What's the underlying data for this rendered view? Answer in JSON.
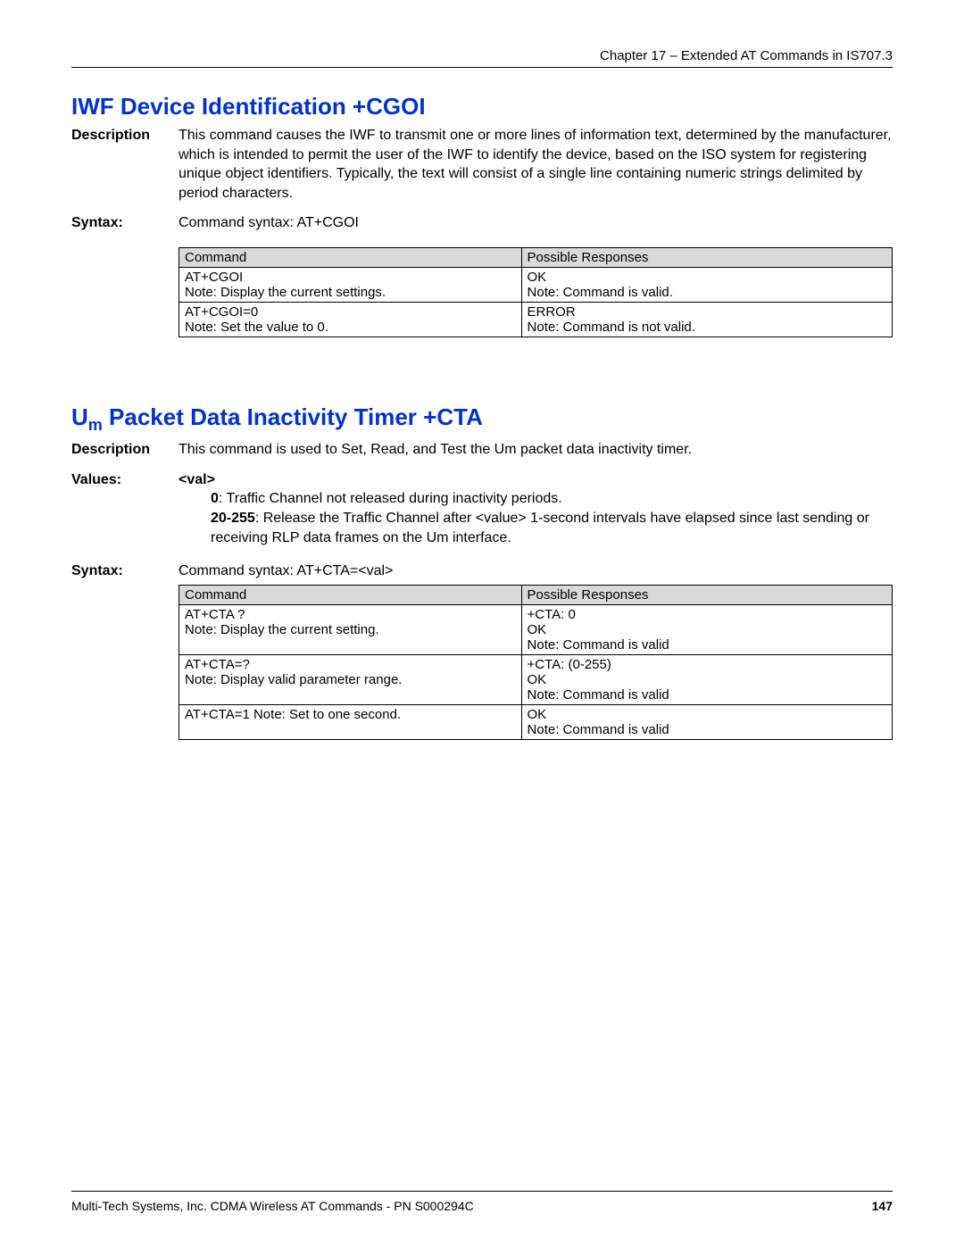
{
  "header": {
    "chapter": "Chapter 17 – Extended AT Commands in IS707.3"
  },
  "section1": {
    "title": "IWF Device Identification  +CGOI",
    "desc_label": "Description",
    "desc_text": "This command causes the IWF to transmit one or more lines of information text, determined by the manufacturer, which is intended to permit the user of the IWF to identify the device, based on the ISO system for registering unique object identifiers. Typically, the text will consist of a single line containing numeric strings delimited by period characters.",
    "syntax_label": "Syntax:",
    "syntax_text": "Command syntax: AT+CGOI",
    "table": {
      "h1": "Command",
      "h2": "Possible Responses",
      "r1c1": "AT+CGOI\nNote: Display the current settings.",
      "r1c2": "OK\nNote: Command is valid.",
      "r2c1": "AT+CGOI=0\nNote: Set the value to 0.",
      "r2c2": "ERROR\nNote: Command is not valid."
    }
  },
  "section2": {
    "title_pre": "U",
    "title_sub": "m",
    "title_post": " Packet Data Inactivity Timer  +CTA",
    "desc_label": "Description",
    "desc_text": "This command is used to Set, Read, and Test the Um packet data inactivity timer.",
    "values_label": "Values:",
    "values_header": "<val>",
    "v0_bold": "0",
    "v0_text": ": Traffic Channel not released during inactivity periods.",
    "v1_bold": "20-255",
    "v1_text": ": Release the Traffic Channel after <value> 1-second intervals have elapsed since last sending or receiving RLP data frames on the Um interface.",
    "syntax_label": "Syntax:",
    "syntax_text": "Command syntax: AT+CTA=<val>",
    "table": {
      "h1": "Command",
      "h2": "Possible Responses",
      "r1c1": "AT+CTA ?\nNote: Display the current setting.",
      "r1c2": "+CTA: 0\nOK\nNote: Command is valid",
      "r2c1": "AT+CTA=?\nNote: Display valid parameter range.",
      "r2c2": "+CTA: (0-255)\nOK\nNote: Command is valid",
      "r3c1": "AT+CTA=1 Note: Set to one second.",
      "r3c2": "OK\nNote: Command is valid"
    }
  },
  "footer": {
    "text": "Multi-Tech Systems, Inc. CDMA Wireless AT Commands - PN S000294C",
    "page": "147"
  }
}
